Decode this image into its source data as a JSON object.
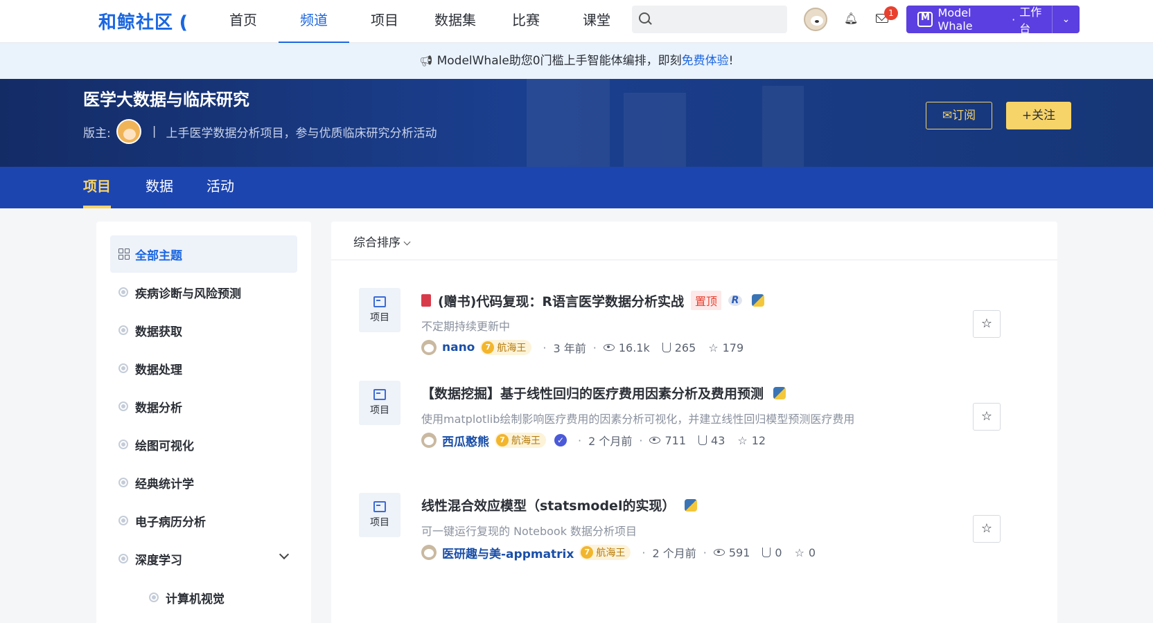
{
  "nav": {
    "logo": "和鲸社区",
    "logo_mark": "❪",
    "links": [
      "首页",
      "频道",
      "项目",
      "数据集",
      "比赛",
      "课堂"
    ],
    "active_index": 1,
    "search_placeholder": "",
    "mail_count": "1",
    "workbench_brand": "Model Whale",
    "workbench_sep": "·",
    "workbench_label": "工作台"
  },
  "announce": {
    "text_before": "ModelWhale助您0门槛上手智能体编排，即刻",
    "link": "免费体验",
    "text_after": "!"
  },
  "banner": {
    "title": "医学大数据与临床研究",
    "moderator_label": "版主:",
    "separator": "|",
    "description": "上手医学数据分析项目，参与优质临床研究分析活动",
    "subscribe_label": "订阅",
    "follow_label": "关注"
  },
  "subtabs": [
    "项目",
    "数据",
    "活动"
  ],
  "sidebar": {
    "items": [
      {
        "label": "全部主题"
      },
      {
        "label": "疾病诊断与风险预测"
      },
      {
        "label": "数据获取"
      },
      {
        "label": "数据处理"
      },
      {
        "label": "数据分析"
      },
      {
        "label": "绘图可视化"
      },
      {
        "label": "经典统计学"
      },
      {
        "label": "电子病历分析"
      },
      {
        "label": "深度学习"
      }
    ],
    "subitems": [
      {
        "label": "计算机视觉"
      }
    ]
  },
  "main": {
    "sort_label": "综合排序",
    "projects": [
      {
        "type": "项目",
        "title": "(赠书)代码复现：R语言医学数据分析实战",
        "pin": "置顶",
        "r_label": "R",
        "desc": "不定期持续更新中",
        "user": "nano",
        "level": "7",
        "badge": "航海王",
        "time": "3 年前",
        "views": "16.1k",
        "forks": "265",
        "stars": "179"
      },
      {
        "type": "项目",
        "title": "【数据挖掘】基于线性回归的医疗费用因素分析及费用预测",
        "desc": "使用matplotlib绘制影响医疗费用的因素分析可视化，并建立线性回归模型预测医疗费用",
        "user": "西瓜憨熊",
        "level": "7",
        "badge": "航海王",
        "verify": "✓",
        "time": "2 个月前",
        "views": "711",
        "forks": "43",
        "stars": "12"
      },
      {
        "type": "项目",
        "title": "线性混合效应模型（statsmodel的实现）",
        "desc": "可一键运行复现的 Notebook 数据分析项目",
        "user": "医研趣与美-appmatrix",
        "level": "7",
        "badge": "航海王",
        "time": "2 个月前",
        "views": "591",
        "forks": "0",
        "stars": "0"
      }
    ]
  }
}
